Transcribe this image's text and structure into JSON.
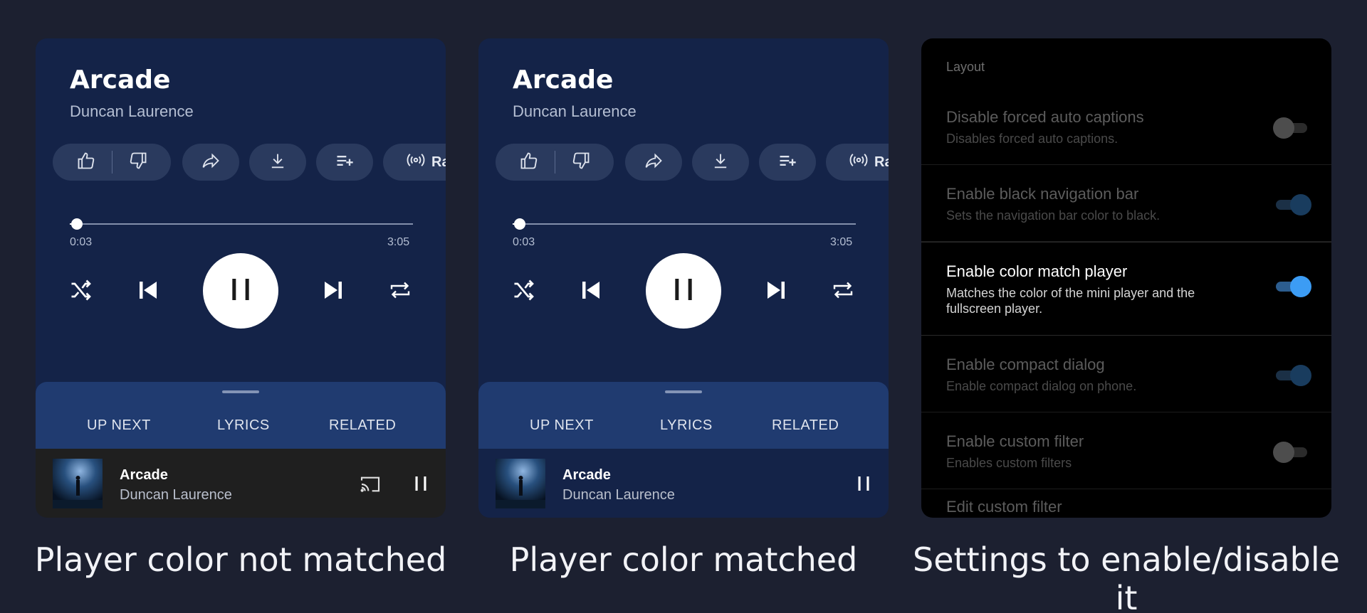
{
  "panels": [
    {
      "song": {
        "title": "Arcade",
        "artist": "Duncan Laurence"
      },
      "actions": {
        "radio_label": "Rac"
      },
      "progress": {
        "current": "0:03",
        "total": "3:05",
        "fraction": 0.016
      },
      "tabs": [
        "UP NEXT",
        "LYRICS",
        "RELATED"
      ],
      "mini_player": {
        "title": "Arcade",
        "artist": "Duncan Laurence",
        "background": "#1f1f1f",
        "show_cast": true
      },
      "caption": "Player color not matched"
    },
    {
      "song": {
        "title": "Arcade",
        "artist": "Duncan Laurence"
      },
      "actions": {
        "radio_label": "Rac"
      },
      "progress": {
        "current": "0:03",
        "total": "3:05",
        "fraction": 0.016
      },
      "tabs": [
        "UP NEXT",
        "LYRICS",
        "RELATED"
      ],
      "mini_player": {
        "title": "Arcade",
        "artist": "Duncan Laurence",
        "background": "#142348",
        "show_cast": false
      },
      "caption": "Player color matched"
    }
  ],
  "settings": {
    "section": "Layout",
    "items": [
      {
        "title": "Disable forced auto captions",
        "subtitle": "Disables forced auto captions.",
        "enabled": false,
        "dimmed": true
      },
      {
        "title": "Enable black navigation bar",
        "subtitle": "Sets the navigation bar color to black.",
        "enabled": true,
        "dimmed": true
      },
      {
        "title": "Enable color match player",
        "subtitle": "Matches the color of the mini player and the fullscreen player.",
        "enabled": true,
        "dimmed": false
      },
      {
        "title": "Enable compact dialog",
        "subtitle": "Enable compact dialog on phone.",
        "enabled": true,
        "dimmed": true
      },
      {
        "title": "Enable custom filter",
        "subtitle": "Enables custom filters",
        "enabled": false,
        "dimmed": true
      }
    ],
    "partial_item_title": "Edit custom filter",
    "caption": "Settings to enable/disable it"
  },
  "colors": {
    "background": "#1c2030",
    "player_bg": "#142348",
    "sheet_bg": "#203b70",
    "toggle_on": "#3c9cf4"
  },
  "icons": [
    "thumb-up-icon",
    "thumb-down-icon",
    "share-icon",
    "download-icon",
    "add-to-queue-icon",
    "radio-icon",
    "shuffle-icon",
    "previous-icon",
    "pause-icon",
    "next-icon",
    "repeat-icon",
    "cast-icon"
  ]
}
